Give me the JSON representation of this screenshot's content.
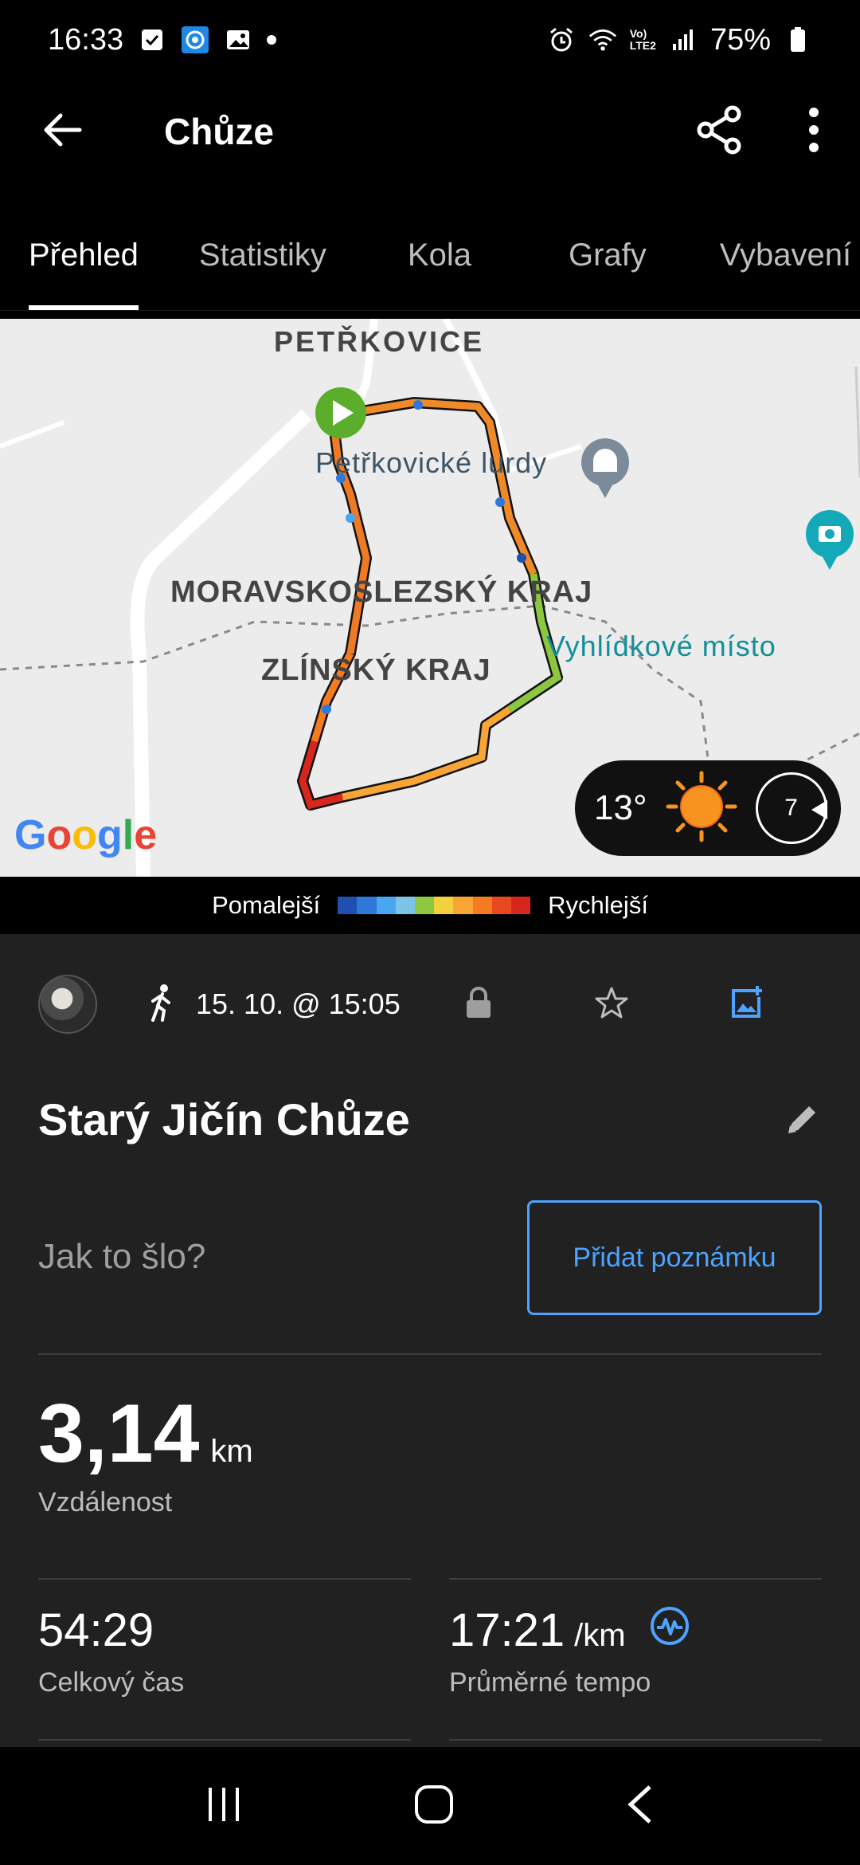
{
  "status": {
    "time": "16:33",
    "battery": "75%",
    "network": "Vo)\nLTE2"
  },
  "appbar": {
    "title": "Chůze"
  },
  "tabs": [
    "Přehled",
    "Statistiky",
    "Kola",
    "Grafy",
    "Vybavení"
  ],
  "map": {
    "labels": {
      "village": "PETŘKOVICE",
      "poi": "Petřkovické lurdy",
      "region1": "MORAVSKOSLEZSKÝ KRAJ",
      "region2": "ZLÍNSKÝ KRAJ",
      "viewpoint": "Vyhlídkové místo"
    },
    "weather": {
      "temp": "13°",
      "wind": "7"
    },
    "brand": "Google"
  },
  "legend": {
    "slower": "Pomalejší",
    "faster": "Rychlejší",
    "colors": [
      "#1f4fb0",
      "#2d78d8",
      "#49a6f0",
      "#7dc3e8",
      "#8dc63f",
      "#f2d13c",
      "#f7a534",
      "#f47b20",
      "#e8471f",
      "#d7261e"
    ]
  },
  "activity": {
    "date": "15. 10. @ 15:05",
    "title": "Starý Jičín Chůze",
    "prompt": "Jak to šlo?",
    "note_button": "Přidat poznámku",
    "distance": {
      "value": "3,14",
      "unit": "km",
      "label": "Vzdálenost"
    },
    "total_time": {
      "value": "54:29",
      "label": "Celkový čas"
    },
    "avg_pace": {
      "value": "17:21",
      "unit": "/km",
      "label": "Průměrné tempo"
    }
  }
}
